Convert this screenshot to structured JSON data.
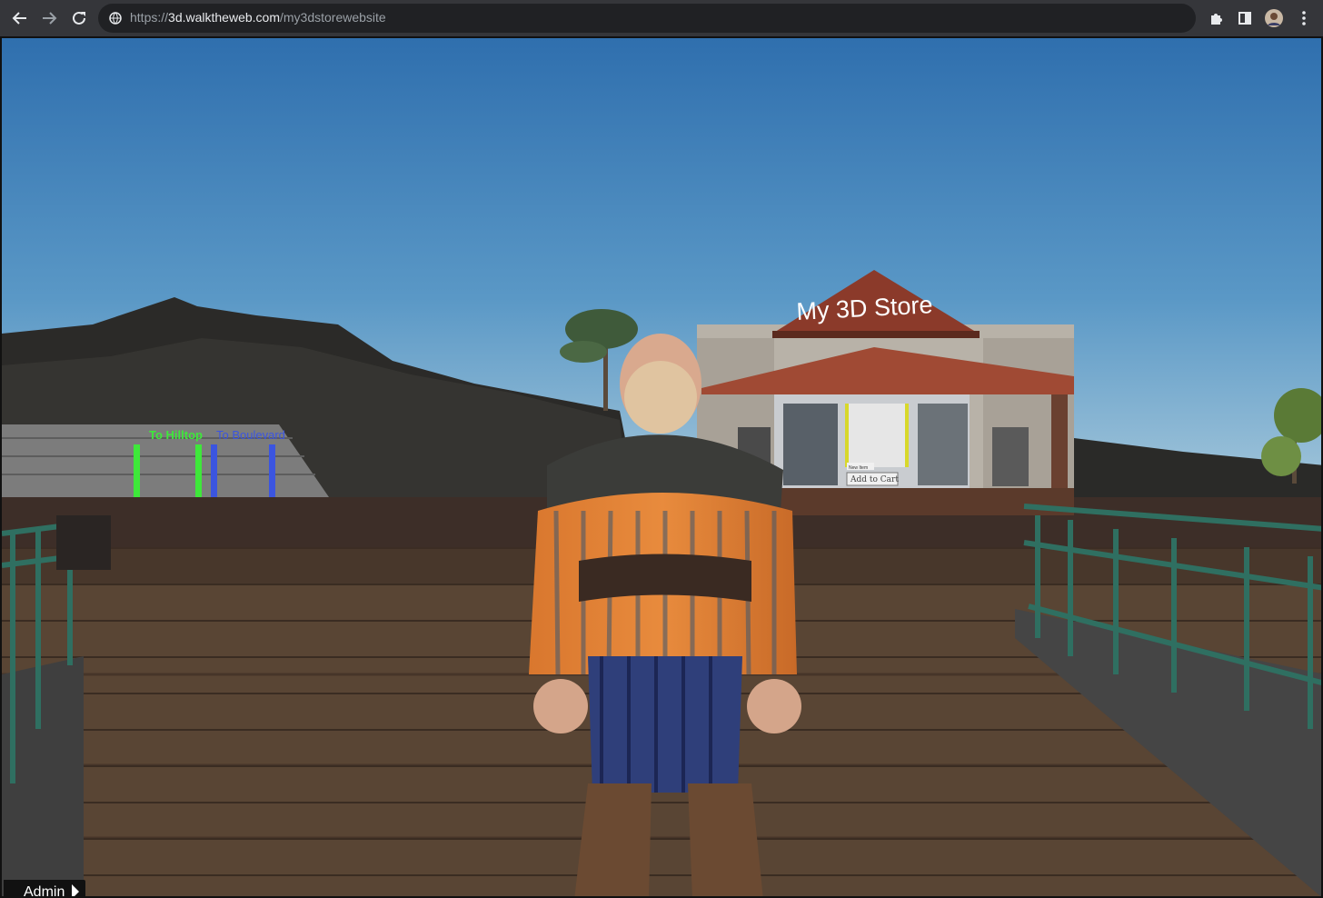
{
  "browser": {
    "url_scheme": "https://",
    "url_host": "3d.walktheweb.com",
    "url_path": "/my3dstorewebsite",
    "icons": [
      "back-icon",
      "forward-icon",
      "reload-icon",
      "site-info-icon",
      "extensions-icon",
      "side-panel-icon",
      "profile-avatar",
      "more-menu-icon"
    ]
  },
  "scene": {
    "store_sign": "My 3D Store",
    "store_price_label": "New Item",
    "store_cart_label": "Add to Cart",
    "portal_labels": [
      "To Hilltop",
      "To Boulevard"
    ],
    "colors": {
      "sky_top": "#2f6fae",
      "sky_bottom": "#9ec4da",
      "deck": "#5a4636",
      "railing": "#2f6f61",
      "portal_green": "#3ee83a",
      "portal_blue": "#3b55e0"
    }
  },
  "overlay": {
    "admin_label": "Admin",
    "menu_icon": "hamburger-menu-icon"
  }
}
